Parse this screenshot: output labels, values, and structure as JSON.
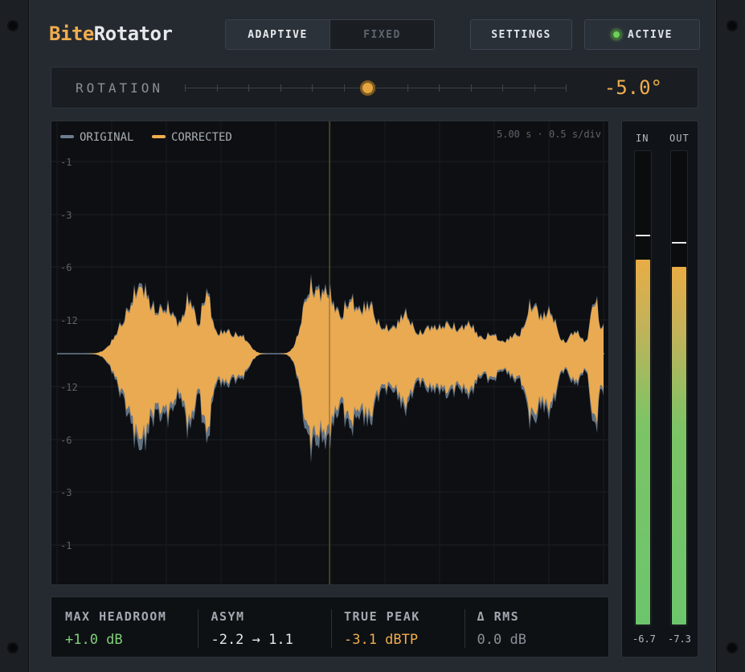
{
  "app": {
    "brand_a": "Bite",
    "brand_b": "Rotator"
  },
  "mode": {
    "options": [
      "ADAPTIVE",
      "FIXED"
    ],
    "selected": "ADAPTIVE"
  },
  "toolbar": {
    "settings_label": "SETTINGS",
    "active_label": "ACTIVE",
    "active_state": true
  },
  "rotation": {
    "label": "ROTATION",
    "value_text": "-5.0°",
    "slider_fraction": 0.48
  },
  "scope": {
    "legend": [
      {
        "label": "ORIGINAL",
        "color": "#6c7d90"
      },
      {
        "label": "CORRECTED",
        "color": "#f0ad4e"
      }
    ],
    "timebase": "5.00 s · 0.5 s/div",
    "ylabels": [
      "-1",
      "-3",
      "-6",
      "-12",
      "-12",
      "-6",
      "-3",
      "-1"
    ]
  },
  "meters": {
    "in": {
      "label": "IN",
      "reading": "-6.7",
      "level": 0.77,
      "peak": 0.82
    },
    "out": {
      "label": "OUT",
      "reading": "-7.3",
      "level": 0.755,
      "peak": 0.805
    }
  },
  "stats": [
    {
      "label": "MAX HEADROOM",
      "value": "+1.0 dB",
      "color": "#7fd07a"
    },
    {
      "label": "ASYM",
      "value": "-2.2 → 1.1",
      "color": "#e6e8eb"
    },
    {
      "label": "TRUE PEAK",
      "value": "-3.1 dBTP",
      "color": "#f0ad4e"
    },
    {
      "label": "Δ RMS",
      "value": "0.0 dB",
      "color": "#8a9098"
    }
  ],
  "colors": {
    "accent": "#f0ad4e",
    "original_wave": "#6c7d90",
    "meter_green": "#6cc56c"
  }
}
